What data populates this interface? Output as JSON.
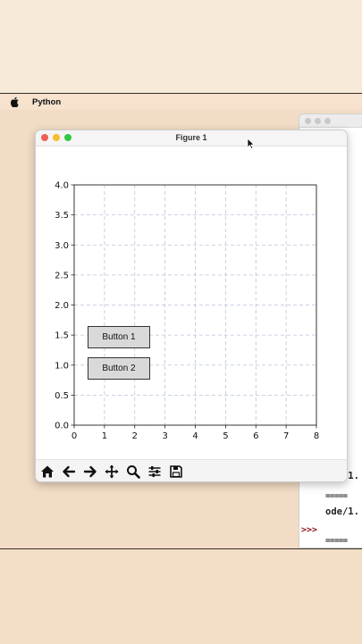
{
  "menubar": {
    "app_name": "Python"
  },
  "window": {
    "title": "Figure 1"
  },
  "chart_data": {
    "type": "scatter",
    "x": [],
    "y": [],
    "xlim": [
      0,
      8
    ],
    "ylim": [
      0,
      4
    ],
    "xticks": [
      "0",
      "1",
      "2",
      "3",
      "4",
      "5",
      "6",
      "7",
      "8"
    ],
    "yticks": [
      "0.0",
      "0.5",
      "1.0",
      "1.5",
      "2.0",
      "2.5",
      "3.0",
      "3.5",
      "4.0"
    ],
    "grid": true,
    "grid_style": "dashed",
    "grid_color": "#b8c4dc",
    "title": "",
    "xlabel": "",
    "ylabel": ""
  },
  "widgets": {
    "button1_label": "Button 1",
    "button2_label": "Button 2"
  },
  "toolbar": {
    "items": [
      "home-icon",
      "back-arrow-icon",
      "forward-arrow-icon",
      "pan-move-icon",
      "zoom-magnifier-icon",
      "configure-subplots-icon",
      "save-floppy-icon"
    ]
  },
  "terminal": {
    "lines": [
      "=====",
      "/1.",
      "=====",
      "/1.",
      "=====",
      "/1.",
      "=====",
      "/1.",
      "=====",
      "/1.",
      "=====",
      "/1.",
      "=====",
      "/1.",
      "=====",
      "/1.",
      "=====",
      "/1.",
      "=====",
      "ode/1.",
      "=====",
      "ode/1."
    ],
    "prompt": ">>>",
    "last_line": "====="
  }
}
